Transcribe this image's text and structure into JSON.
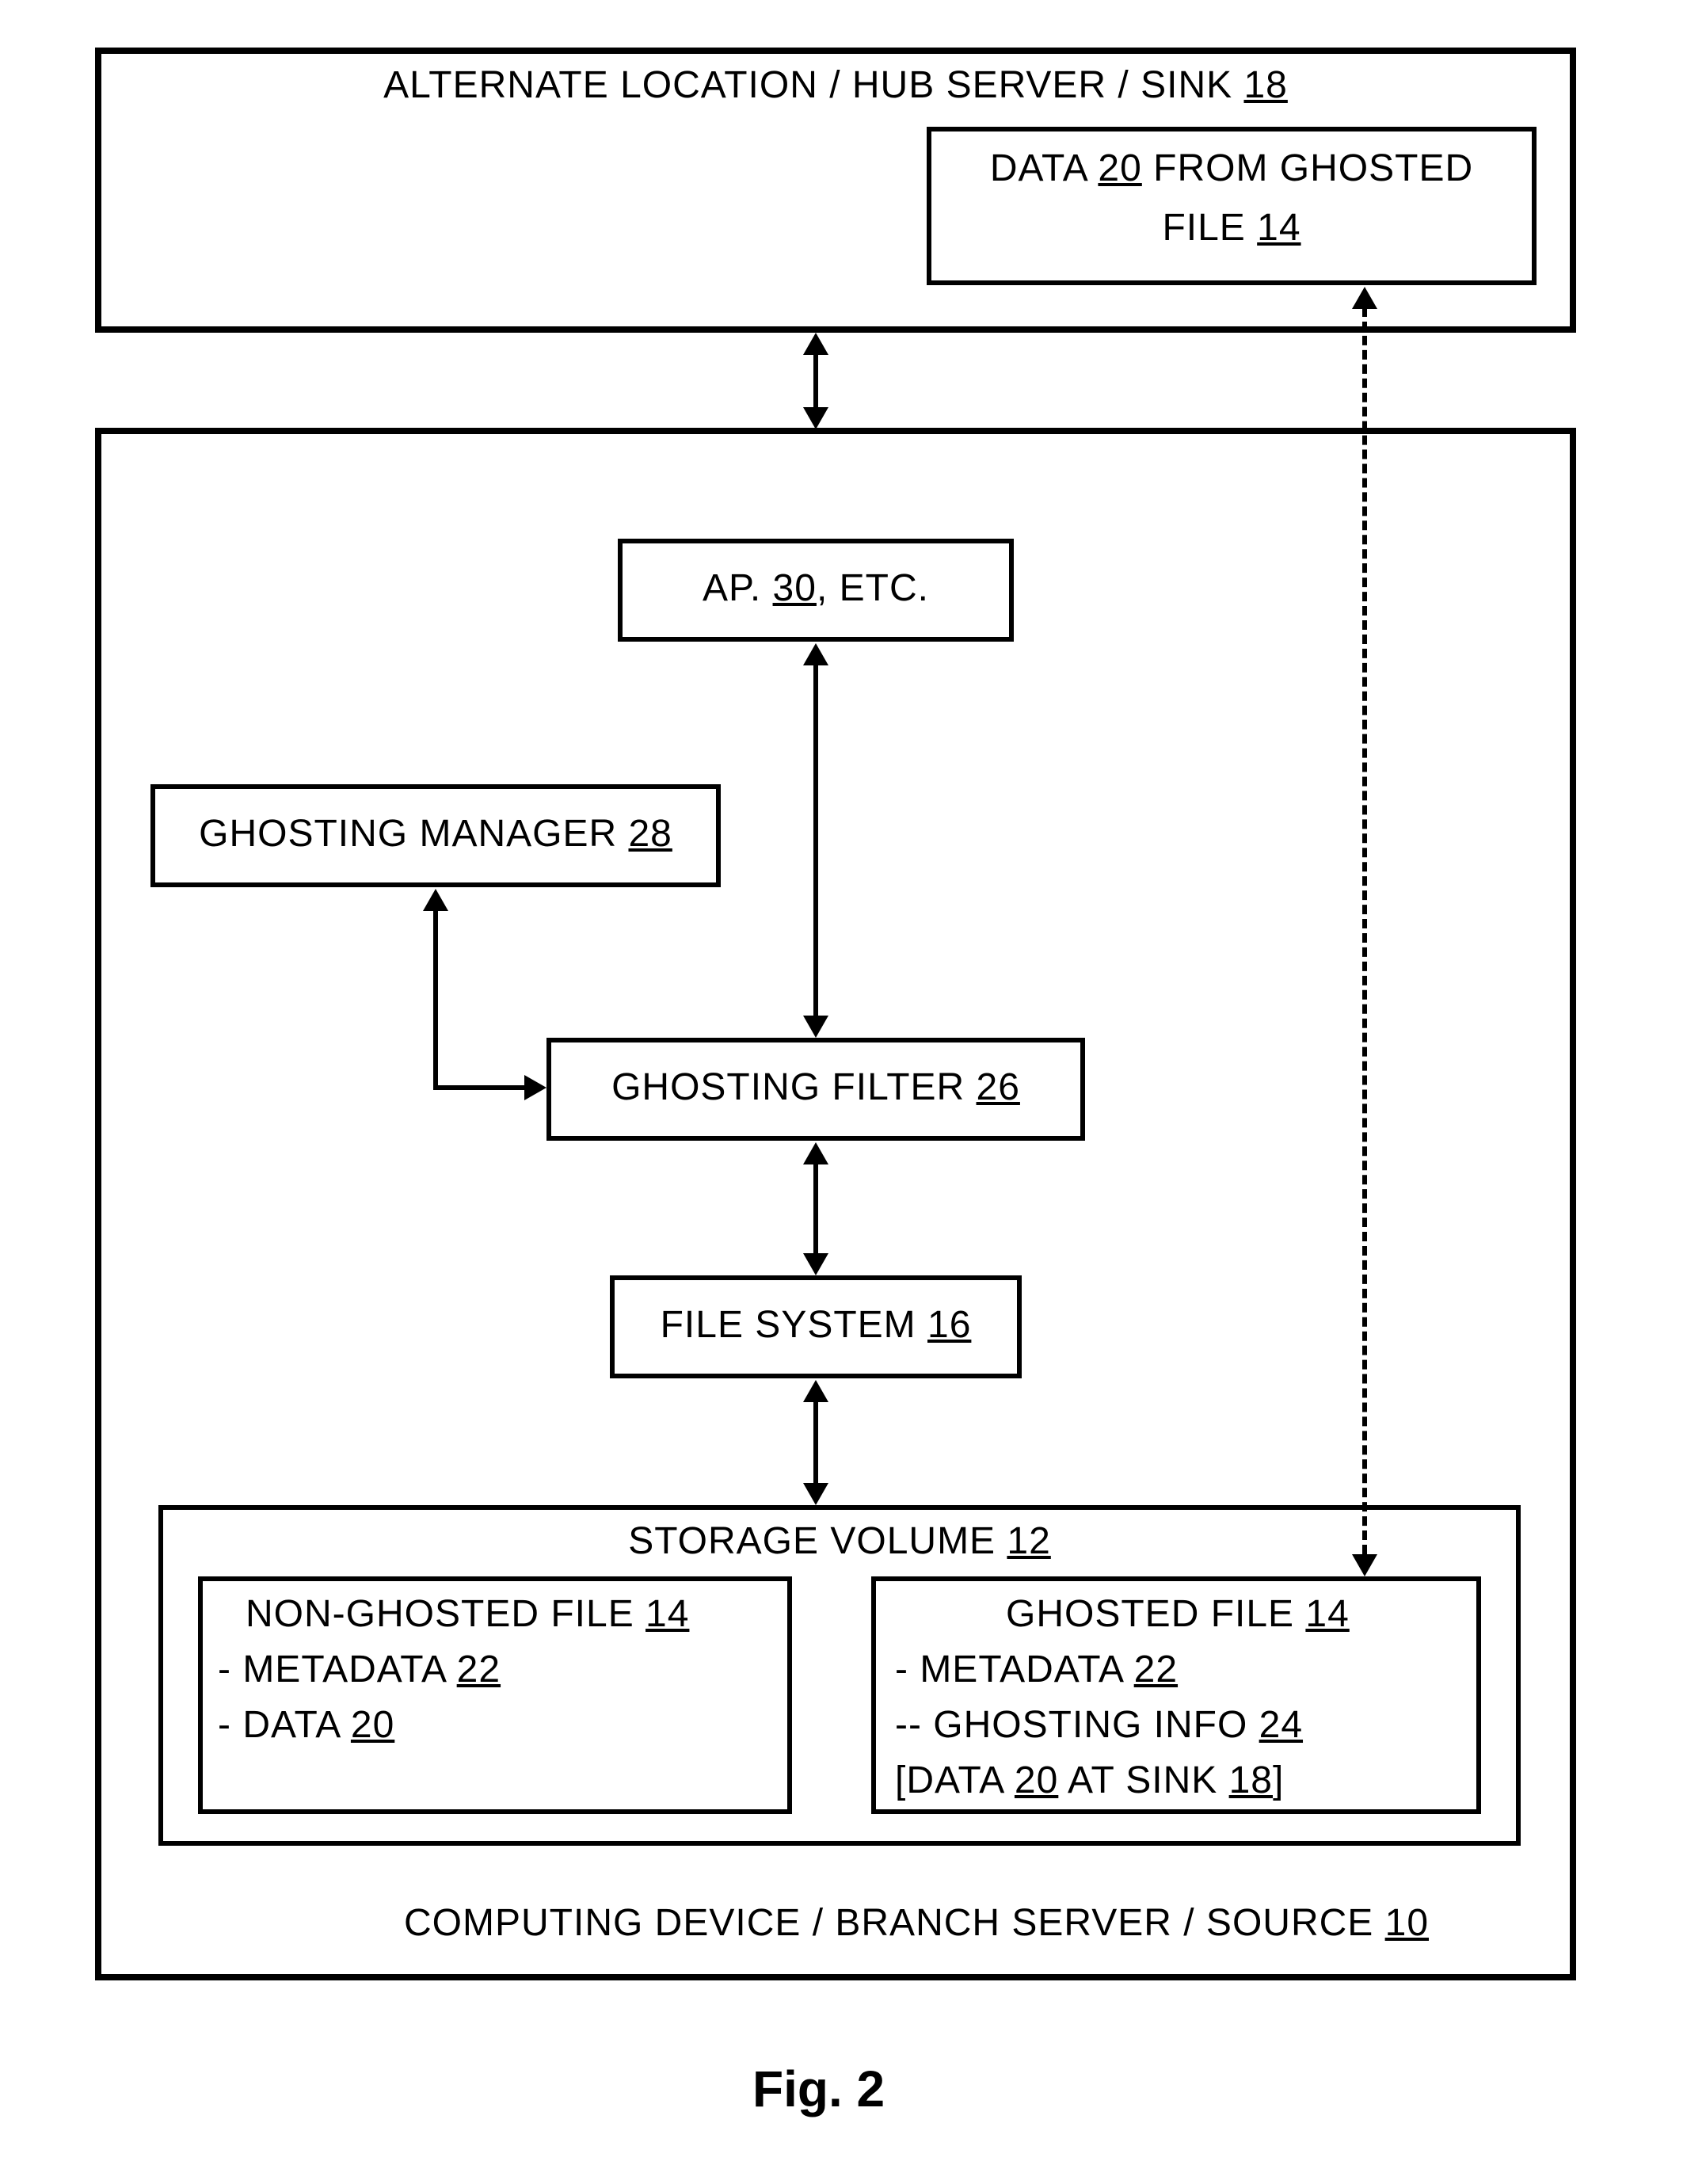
{
  "figure_label": "Fig. 2",
  "hub": {
    "title_pre": "ALTERNATE LOCATION / HUB SERVER / SINK ",
    "title_num": "18",
    "databox_l1_pre": "DATA ",
    "databox_l1_mid": "20",
    "databox_l1_post": " FROM GHOSTED",
    "databox_l2_pre": "FILE ",
    "databox_l2_num": "14"
  },
  "device": {
    "footer_pre": "COMPUTING DEVICE / BRANCH SERVER / SOURCE ",
    "footer_num": "10",
    "ap_pre": "AP. ",
    "ap_num": "30",
    "ap_post": ", ETC.",
    "gm_pre": "GHOSTING MANAGER ",
    "gm_num": "28",
    "gf_pre": "GHOSTING FILTER ",
    "gf_num": "26",
    "fs_pre": "FILE SYSTEM ",
    "fs_num": "16",
    "sv_pre": "STORAGE VOLUME ",
    "sv_num": "12",
    "ngf_title_pre": "NON-GHOSTED FILE ",
    "ngf_title_num": "14",
    "ngf_meta_pre": "- METADATA ",
    "ngf_meta_num": "22",
    "ngf_data_pre": "- DATA ",
    "ngf_data_num": "20",
    "gf2_title_pre": "GHOSTED FILE ",
    "gf2_title_num": "14",
    "gf2_meta_pre": "- METADATA ",
    "gf2_meta_num": "22",
    "gf2_ginfo_pre": "-- GHOSTING INFO ",
    "gf2_ginfo_num": "24",
    "gf2_data_pre": "[DATA ",
    "gf2_data_mid": "20",
    "gf2_data_mid2": " AT SINK ",
    "gf2_data_end": "18",
    "gf2_data_close": "]"
  }
}
